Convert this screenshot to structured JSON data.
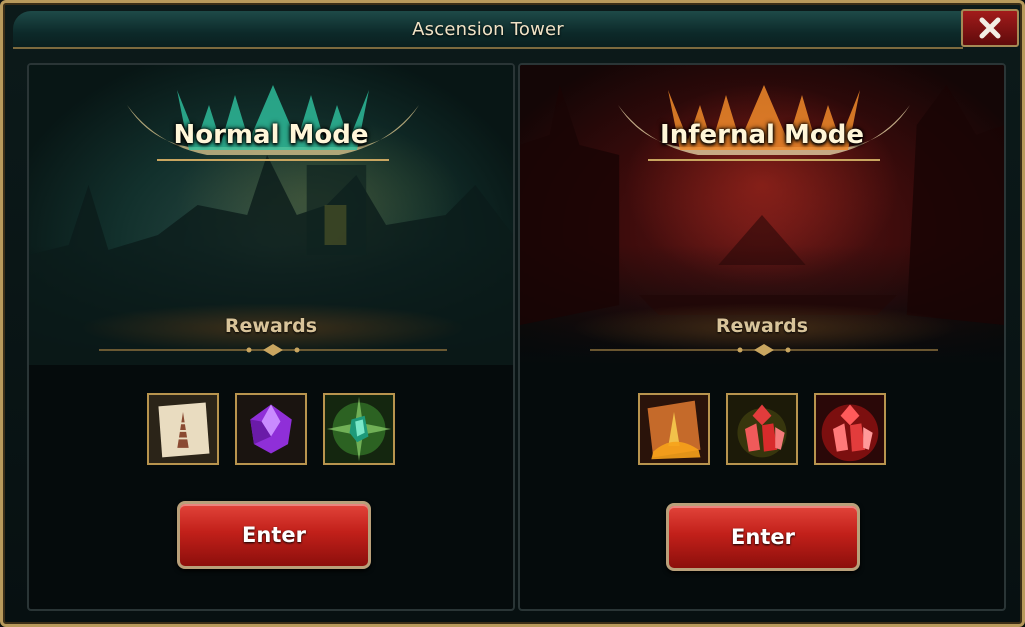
{
  "window": {
    "title": "Ascension Tower"
  },
  "close_icon": "close-x-icon",
  "modes": [
    {
      "title": "Normal Mode",
      "theme": "teal",
      "rewards_label": "Rewards",
      "rewards": [
        {
          "icon": "tower-scroll-icon"
        },
        {
          "icon": "purple-gem-icon"
        },
        {
          "icon": "green-crystal-icon"
        }
      ],
      "enter_label": "Enter"
    },
    {
      "title": "Infernal Mode",
      "theme": "red",
      "rewards_label": "Rewards",
      "rewards": [
        {
          "icon": "infernal-scroll-icon"
        },
        {
          "icon": "red-crystal-icon"
        },
        {
          "icon": "red-crystal-glow-icon"
        }
      ],
      "enter_label": "Enter"
    }
  ],
  "colors": {
    "frame_gold": "#b89a5c",
    "title_bar": "#1e4a48",
    "enter_red": "#c2201a",
    "close_red": "#a21b1b"
  }
}
